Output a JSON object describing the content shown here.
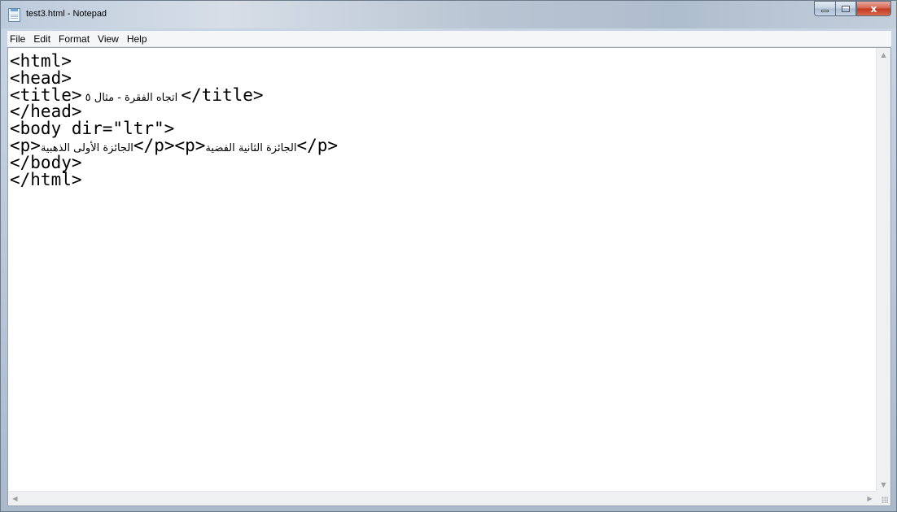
{
  "window": {
    "title": "test3.html - Notepad",
    "controls": {
      "minimize": "",
      "maximize": "",
      "close": "x"
    }
  },
  "menu": [
    "File",
    "Edit",
    "Format",
    "View",
    "Help"
  ],
  "editor": {
    "lines": [
      {
        "parts": [
          {
            "t": "<html>",
            "ar": false
          }
        ]
      },
      {
        "parts": [
          {
            "t": "<head>",
            "ar": false
          }
        ]
      },
      {
        "parts": [
          {
            "t": "<title>",
            "ar": false
          },
          {
            "t": " اتجاه الفقرة - مثال ٥ ",
            "ar": true
          },
          {
            "t": "</title>",
            "ar": false
          }
        ]
      },
      {
        "parts": [
          {
            "t": "</head>",
            "ar": false
          }
        ]
      },
      {
        "parts": [
          {
            "t": "<body dir=\"ltr\">",
            "ar": false
          }
        ]
      },
      {
        "parts": [
          {
            "t": "<p>",
            "ar": false
          },
          {
            "t": "الجائزة الأولى الذهبية",
            "ar": true
          },
          {
            "t": "</p><p>",
            "ar": false
          },
          {
            "t": "الجائزة الثانية الفضية",
            "ar": true
          },
          {
            "t": "</p>",
            "ar": false
          }
        ]
      },
      {
        "parts": [
          {
            "t": "</body>",
            "ar": false
          }
        ]
      },
      {
        "parts": [
          {
            "t": "</html>",
            "ar": false
          }
        ]
      }
    ]
  },
  "scrollbars": {
    "up": "▲",
    "down": "▼",
    "left": "◀",
    "right": "▶"
  }
}
